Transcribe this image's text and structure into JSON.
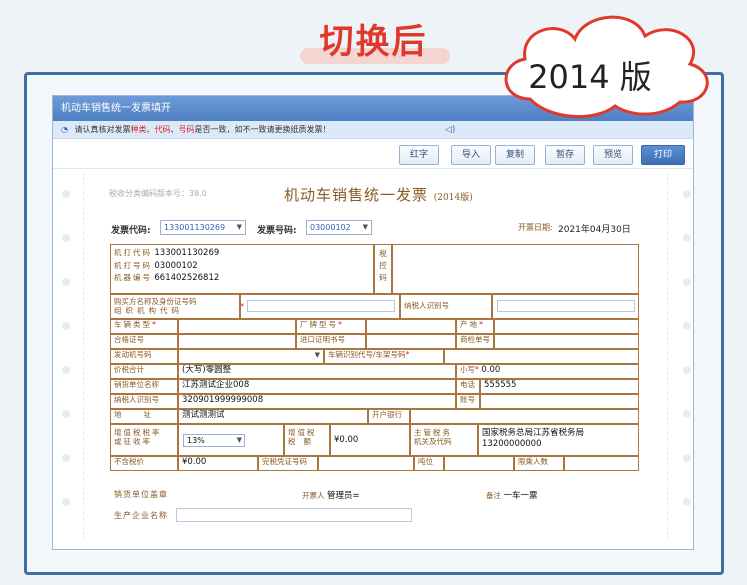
{
  "headline": "切换后",
  "badge": "2014 版",
  "window": {
    "title": "机动车销售统一发票填开",
    "notice": {
      "prefix": "请认真核对发票",
      "kind": "种类",
      "sep1": "、",
      "code": "代码",
      "sep2": "、",
      "number": "号码",
      "suffix": "是否一致，如不一致请更换纸质发票！"
    },
    "buttons": [
      "红字",
      "导入",
      "复制",
      "暂存",
      "预览",
      "打印"
    ]
  },
  "invoice": {
    "watermark": "税收分类编码版本号：38.0",
    "title": "机动车销售统一发票",
    "version": "(2014版)",
    "code_label": "发票代码:",
    "code_value": "133001130269",
    "number_label": "发票号码:",
    "number_value": "03000102",
    "date_label": "开票日期:",
    "date_value": "2021年04月30日",
    "machine_code_label": "机打代码",
    "machine_code": "133001130269",
    "machine_number_label": "机打号码",
    "machine_number": "03000102",
    "machine_serial_label": "机器编号",
    "machine_serial": "661402526812",
    "tax_control_label": "税控码",
    "buyer_label_1": "购买方名称及身份证号码",
    "buyer_label_2": "组织机构代码",
    "buyer_taxid_label": "纳税人识别号",
    "vehicle_type_label": "车辆类型",
    "brand_label": "厂牌型号",
    "origin_label": "产地",
    "cert_label": "合格证号",
    "import_cert_label": "进口证明书号",
    "inspection_label": "商检单号",
    "engine_label": "发动机号码",
    "vin_label": "车辆识别代号/车架号码",
    "total_label": "价税合计",
    "total_upper_prefix": "(大写)",
    "total_upper": "零圆整",
    "total_lower_label": "小写",
    "total_lower": "0.00",
    "seller_label": "销货单位名称",
    "seller_name": "江苏测试企业008",
    "phone_label": "电话",
    "phone": "555555",
    "seller_taxid_label": "纳税人识别号",
    "seller_taxid": "320901999999008",
    "account_label": "账号",
    "address_label": "地址",
    "address": "测试测测试",
    "bank_label": "开户银行",
    "vat_rate_label_1": "增值税税率",
    "vat_rate_label_2": "或征收率",
    "vat_rate": "13%",
    "vat_amount_label_1": "增值税",
    "vat_amount_label_2": "税额",
    "vat_amount": "¥0.00",
    "authority_label_1": "主管税务",
    "authority_label_2": "机关及代码",
    "authority_name": "国家税务总局江苏省税务局",
    "authority_code": "13200000000",
    "price_ex_label": "不含税价",
    "price_ex": "¥0.00",
    "tax_cert_label": "完税凭证号码",
    "tonnage_label": "吨位",
    "seats_label": "限乘人数",
    "seal_label": "销货单位盖章",
    "drawer_label": "开票人",
    "drawer": "管理员=",
    "remark_label": "备注",
    "remark": "一车一票",
    "manufacturer_label": "生产企业名称"
  }
}
